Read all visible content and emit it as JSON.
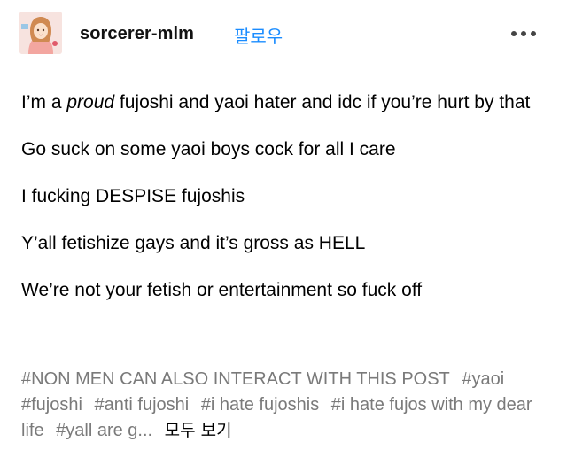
{
  "post": {
    "author": "sorcerer-mlm",
    "follow_label": "팔로우",
    "more_icon": "ellipsis-horizontal-icon",
    "avatar_icon": "user-avatar-icon",
    "accent_color": "#1a8cff",
    "tag_color": "#7a7a7a",
    "paragraphs": {
      "p1_a": "I’m a ",
      "p1_b": "proud",
      "p1_c": " fujoshi and yaoi hater and idc if you’re hurt by that",
      "p2": "Go suck on some yaoi boys cock for all I care",
      "p3": "I fucking DESPISE fujoshis",
      "p4": "Y’all fetishize gays and it’s gross as HELL",
      "p5": "We’re not your fetish or entertainment so fuck off"
    },
    "tags": [
      "#NON MEN CAN ALSO INTERACT WITH THIS POST",
      "#yaoi",
      "#fujoshi",
      "#anti fujoshi",
      "#i hate fujoshis",
      "#i hate fujos with my dear life",
      "#yall are g..."
    ],
    "see_all_label": "모두 보기"
  }
}
